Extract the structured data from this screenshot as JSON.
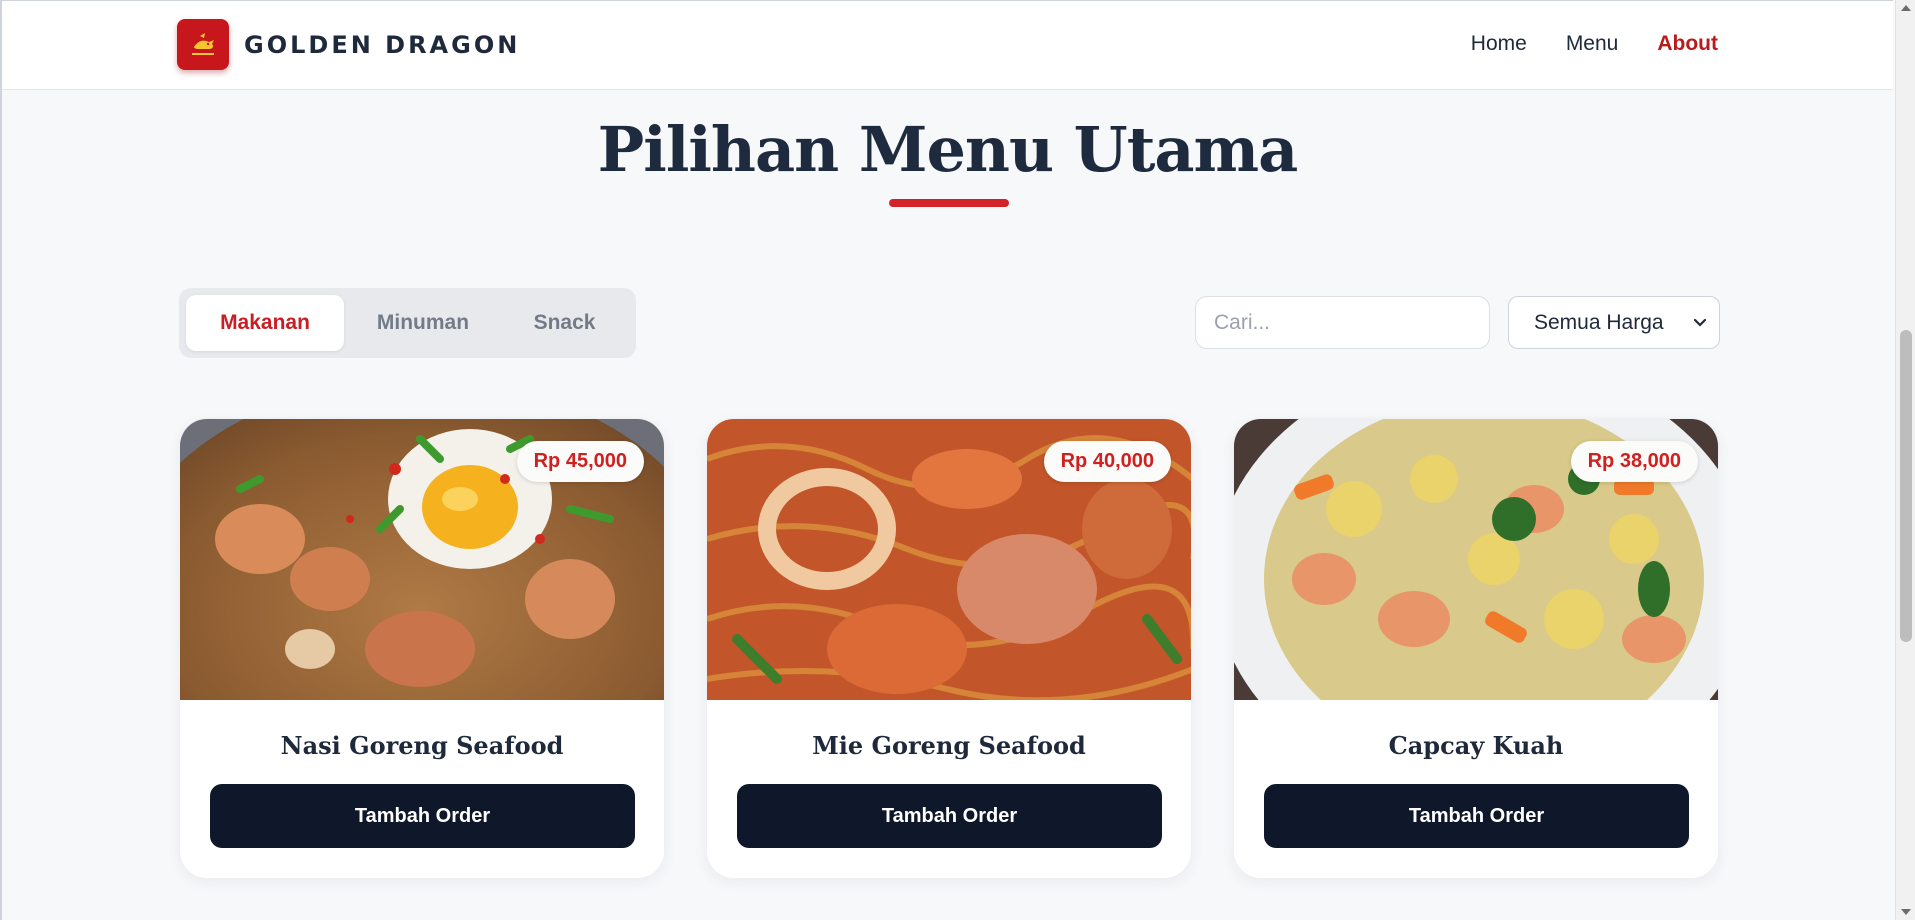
{
  "brand": {
    "name": "GOLDEN DRAGON",
    "logo_icon": "dragon-icon",
    "logo_color": "#c8171c"
  },
  "nav": {
    "items": [
      "Home",
      "Menu",
      "About"
    ],
    "active": "About",
    "active_color": "#b91c1c"
  },
  "title": "Pilihan Menu Utama",
  "tabs": {
    "items": [
      "Makanan",
      "Minuman",
      "Snack"
    ],
    "active": "Makanan"
  },
  "search": {
    "placeholder": "Cari...",
    "value": ""
  },
  "price_filter": {
    "selected": "Semua Harga"
  },
  "cards": [
    {
      "name": "Nasi Goreng Seafood",
      "price": "Rp 45,000",
      "button": "Tambah Order",
      "image": "fried-rice-photo"
    },
    {
      "name": "Mie Goreng Seafood",
      "price": "Rp 40,000",
      "button": "Tambah Order",
      "image": "fried-noodles-photo"
    },
    {
      "name": "Capcay Kuah",
      "price": "Rp 38,000",
      "button": "Tambah Order",
      "image": "capcay-soup-photo"
    }
  ],
  "colors": {
    "accent": "#d42328",
    "button_dark": "#0f172a",
    "page_bg": "#f7f8fa"
  }
}
